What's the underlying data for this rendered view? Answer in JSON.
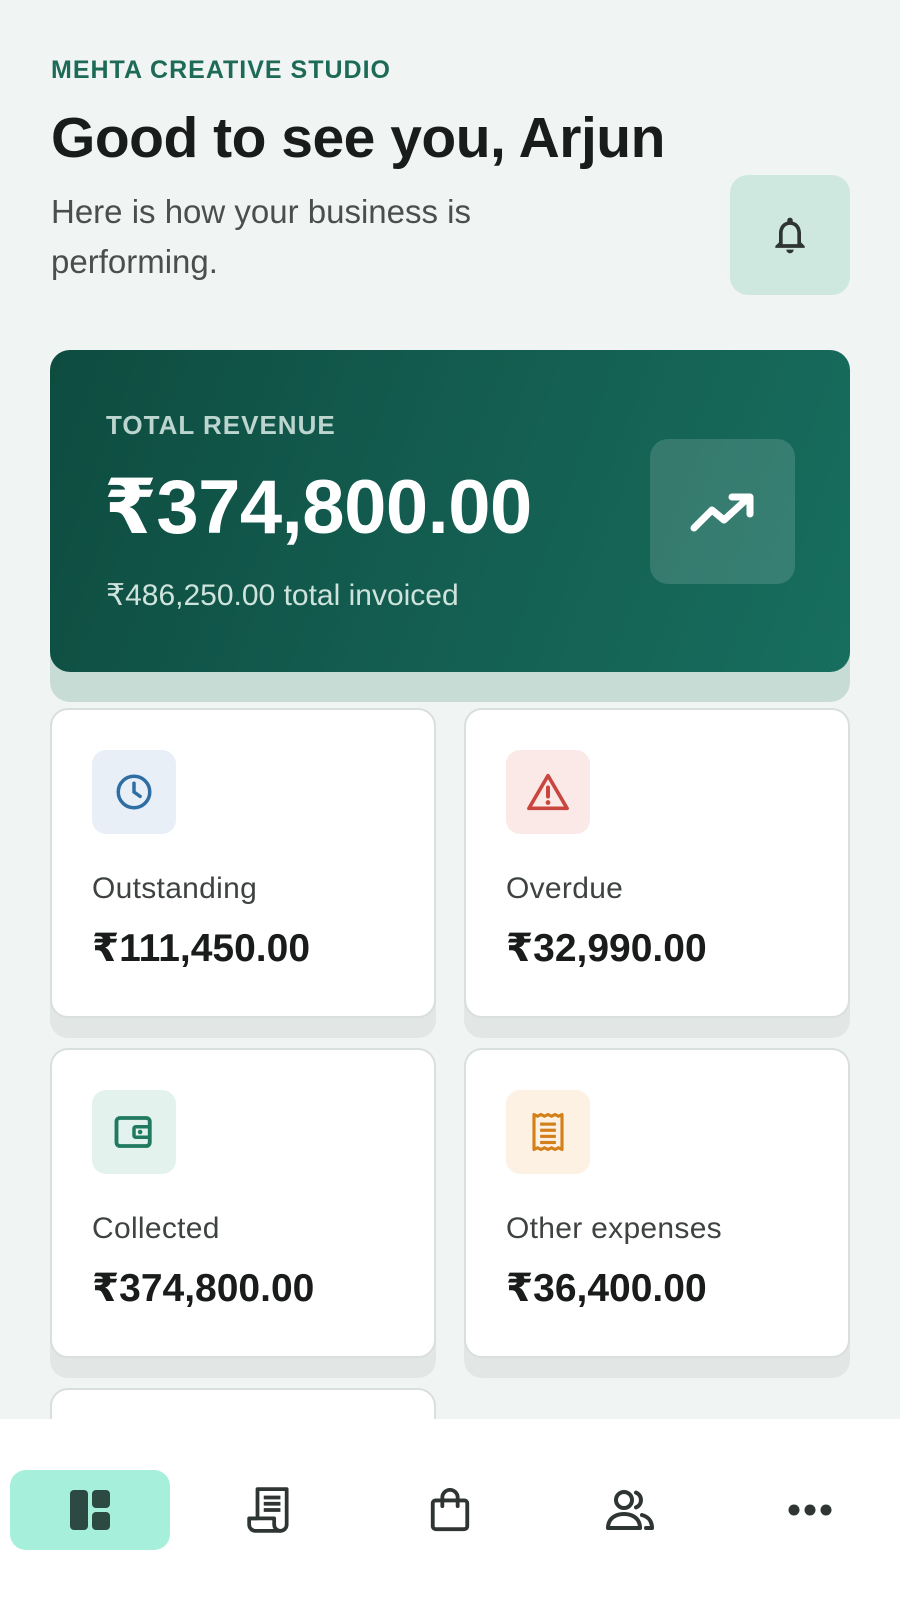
{
  "header": {
    "company": "MEHTA CREATIVE STUDIO",
    "greeting": "Good to see you, Arjun",
    "subtitle": "Here is how your business is performing."
  },
  "revenue": {
    "label": "TOTAL REVENUE",
    "amount": "₹374,800.00",
    "invoiced": "₹486,250.00 total invoiced"
  },
  "stats": [
    {
      "label": "Outstanding",
      "value": "₹111,450.00",
      "icon": "clock-icon",
      "color": "#2f6ea3",
      "bg": "#e8eff7"
    },
    {
      "label": "Overdue",
      "value": "₹32,990.00",
      "icon": "warning-icon",
      "color": "#c9453d",
      "bg": "#fbe9e8"
    },
    {
      "label": "Collected",
      "value": "₹374,800.00",
      "icon": "wallet-icon",
      "color": "#1f7a5f",
      "bg": "#e3f2ed"
    },
    {
      "label": "Other expenses",
      "value": "₹36,400.00",
      "icon": "receipt-icon",
      "color": "#d4801a",
      "bg": "#fdf1e3"
    }
  ],
  "nav": {
    "items": [
      {
        "name": "dashboard",
        "icon": "dashboard-icon",
        "active": true
      },
      {
        "name": "invoices",
        "icon": "invoice-icon",
        "active": false
      },
      {
        "name": "purchases",
        "icon": "shopping-bag-icon",
        "active": false
      },
      {
        "name": "clients",
        "icon": "people-icon",
        "active": false
      },
      {
        "name": "more",
        "icon": "more-icon",
        "active": false
      }
    ]
  },
  "colors": {
    "brand": "#1d6b57",
    "revenue_card": "#145f52",
    "nav_active": "#a6f0db"
  }
}
